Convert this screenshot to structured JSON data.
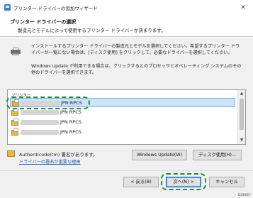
{
  "window": {
    "title": "プリンター ドライバーの追加ウィザード",
    "close_glyph": "✕"
  },
  "header": {
    "heading": "プリンター ドライバーの選択",
    "subheading": "製造元とモデルによって使用するプリンター ドライバーが決まります。"
  },
  "instructions": {
    "paragraph1": "インストールするプリンター ドライバーの製造元とモデルを選択してください。希望するプリンター ドライバーが一覧にない場合は、[ディスク使用] をクリックして、必要なドライバーを選択してください。",
    "paragraph2": "Windows Update が利用できる場合は、クリックするとのプロセッサとオペレーティング システムのその他のドライバーを選択できます。"
  },
  "driver_list": {
    "header": "プリンター",
    "items": [
      {
        "label": "JPN RPCS",
        "selected": true
      },
      {
        "label": "JPN RPCS",
        "selected": false
      },
      {
        "label": "JPN RPCS",
        "selected": false
      },
      {
        "label": "JPN RPCS",
        "selected": false
      }
    ],
    "scroll_up": "▲",
    "scroll_down": "▼"
  },
  "signature": {
    "text": "Authenticode(tm) 署名があります。",
    "link": "ドライバーの署名が重要な理由"
  },
  "buttons": {
    "windows_update": "Windows Update(W)",
    "have_disk": "ディスク使用(H)...",
    "back": "< 戻る(B)",
    "next": "次へ(N) >",
    "cancel": "キャンセル"
  },
  "figure_id": "DZB667",
  "colors": {
    "selection": "#cde4f7",
    "callout": "#1f8c3a",
    "link": "#1a5fb4",
    "primary_button_border": "#1a73c9"
  }
}
